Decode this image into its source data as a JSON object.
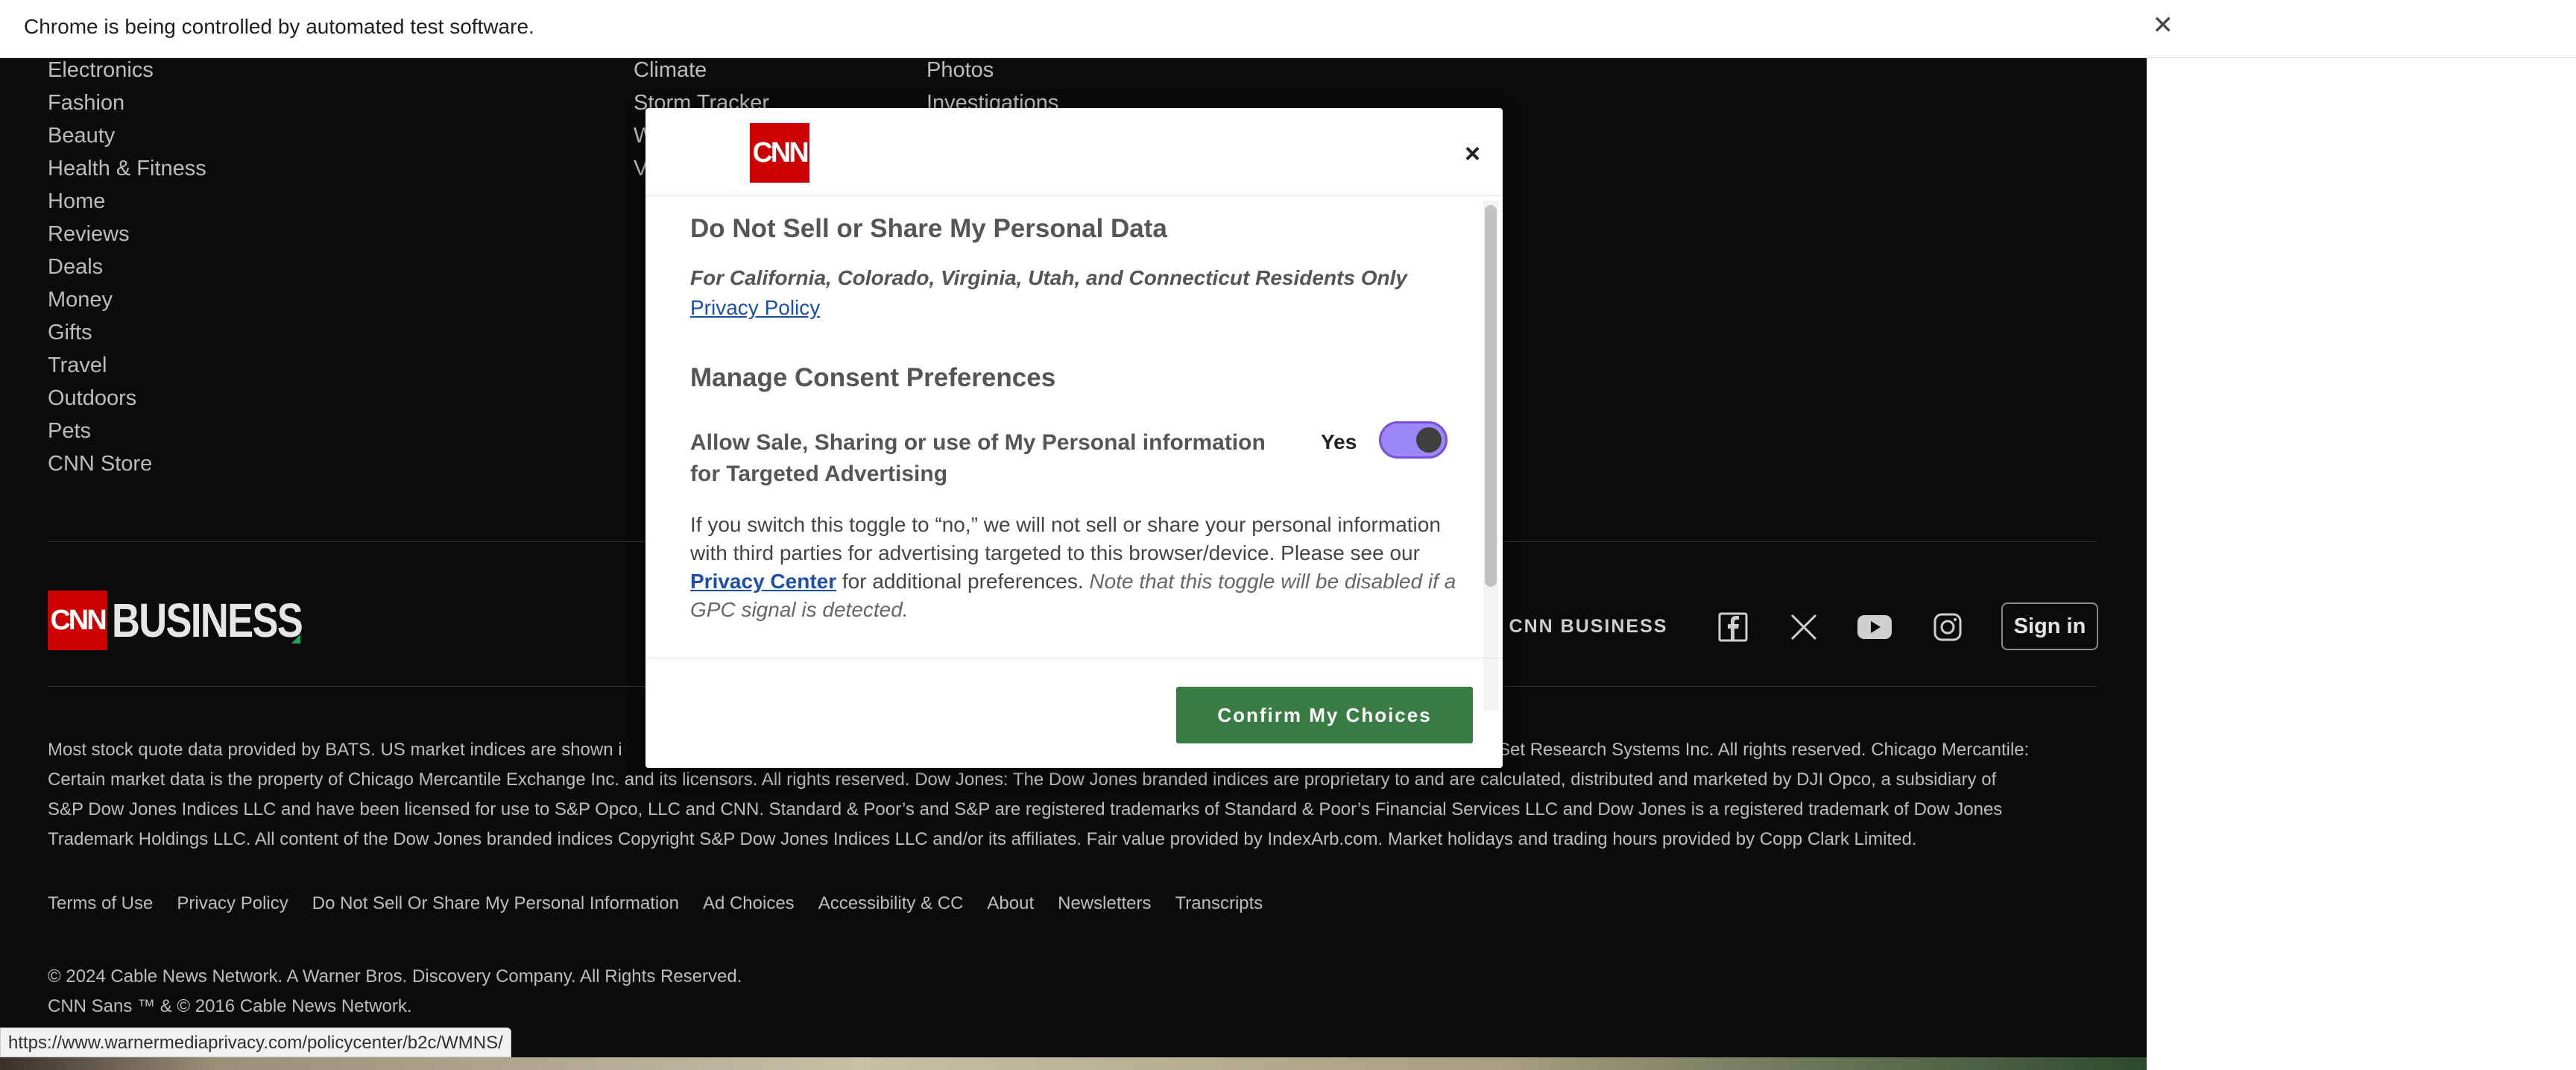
{
  "browser": {
    "infobar_message": "Chrome is being controlled by automated test software.",
    "close_glyph": "✕",
    "status_url": "https://www.warnermediaprivacy.com/policycenter/b2c/WMNS/"
  },
  "footer_nav": {
    "col1": [
      "Electronics",
      "Fashion",
      "Beauty",
      "Health & Fitness",
      "Home",
      "Reviews",
      "Deals",
      "Money",
      "Gifts",
      "Travel",
      "Outdoors",
      "Pets",
      "CNN Store"
    ],
    "col2": [
      "Climate",
      "Storm Tracker",
      "W",
      "V"
    ],
    "col3": [
      "Photos",
      "Investigations"
    ]
  },
  "brand": {
    "cnn_logo_text": "CNN",
    "business_text": "BUSINESS",
    "red": "#cc0000",
    "green_tick": "#1fa85a"
  },
  "follow": {
    "label": "W CNN BUSINESS",
    "icons": [
      "facebook-icon",
      "x-icon",
      "youtube-icon",
      "instagram-icon"
    ],
    "sign_in": "Sign in"
  },
  "disclaimer": {
    "line1_start": "Most stock quote data provided by BATS. US market indices are shown i",
    "line1_end": "Set Research Systems Inc. All rights reserved. Chicago Mercantile:",
    "line2": "Certain market data is the property of Chicago Mercantile Exchange Inc. and its licensors. All rights reserved. Dow Jones: The Dow Jones branded indices are proprietary to and are calculated, distributed and marketed by DJI Opco, a subsidiary of",
    "line3": "S&P Dow Jones Indices LLC and have been licensed for use to S&P Opco, LLC and CNN. Standard & Poor’s and S&P are registered trademarks of Standard & Poor’s Financial Services LLC and Dow Jones is a registered trademark of Dow Jones",
    "line4": "Trademark Holdings LLC. All content of the Dow Jones branded indices Copyright S&P Dow Jones Indices LLC and/or its affiliates. Fair value provided by IndexArb.com. Market holidays and trading hours provided by Copp Clark Limited."
  },
  "footer_links": [
    "Terms of Use",
    "Privacy Policy",
    "Do Not Sell Or Share My Personal Information",
    "Ad Choices",
    "Accessibility & CC",
    "About",
    "Newsletters",
    "Transcripts"
  ],
  "copyright": {
    "line1": "© 2024 Cable News Network. A Warner Bros. Discovery Company. All Rights Reserved.",
    "line2": "CNN Sans ™ & © 2016 Cable News Network."
  },
  "modal": {
    "logo_text": "CNN",
    "close_glyph": "×",
    "title": "Do Not Sell or Share My Personal Data",
    "subtitle": "For California, Colorado, Virginia, Utah, and Connecticut Residents Only",
    "privacy_policy_link": "Privacy Policy",
    "section_title": "Manage Consent Preferences",
    "toggle_label": "Allow Sale, Sharing or use of My Personal information for Targeted Advertising",
    "toggle_value_label": "Yes",
    "toggle_on": true,
    "toggle_color": "#9b87f5",
    "desc_part1": "If you switch this toggle to “no,” we will not sell or share your personal information with third parties for advertising targeted to this browser/device. Please see our",
    "desc_link": "Privacy Center",
    "desc_part2": "for additional preferences.",
    "desc_note": "Note that this toggle will be disabled if a GPC signal is detected.",
    "confirm_button": "Confirm My Choices",
    "confirm_color": "#3a7d44"
  }
}
